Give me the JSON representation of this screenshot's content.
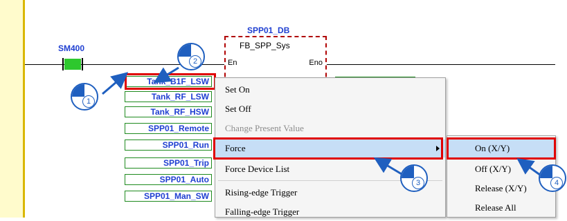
{
  "ladder": {
    "contact_label": "SM400",
    "fb_instance": "SPP01_DB",
    "fb_name": "FB_SPP_Sys",
    "fb_en": "En",
    "fb_eno": "Eno",
    "variables": [
      "Tank_B1F_LSW",
      "Tank_RF_LSW",
      "Tank_RF_HSW",
      "SPP01_Remote",
      "SPP01_Run",
      "SPP01_Trip",
      "SPP01_Auto",
      "SPP01_Man_SW"
    ]
  },
  "context_menu": {
    "items": [
      {
        "label": "Set On",
        "state": "normal"
      },
      {
        "label": "Set Off",
        "state": "normal"
      },
      {
        "label": "Change Present Value",
        "state": "disabled"
      },
      {
        "label": "Force",
        "state": "highlighted",
        "has_submenu": true
      },
      {
        "label": "Force Device List",
        "state": "normal"
      },
      {
        "label": "Rising-edge Trigger",
        "state": "normal"
      },
      {
        "label": "Falling-edge Trigger",
        "state": "normal"
      }
    ]
  },
  "force_submenu": {
    "items": [
      {
        "label": "On (X/Y)",
        "state": "highlighted"
      },
      {
        "label": "Off (X/Y)",
        "state": "normal"
      },
      {
        "label": "Release (X/Y)",
        "state": "normal"
      },
      {
        "label": "Release All",
        "state": "normal"
      }
    ]
  },
  "step_badges": [
    "1",
    "2",
    "3",
    "4"
  ],
  "icons": [
    "step-1-badge-icon",
    "step-2-badge-icon",
    "step-3-badge-icon",
    "step-4-badge-icon",
    "submenu-arrow-icon",
    "pointer-arrow-icon"
  ],
  "colors": {
    "variable_text": "#1f3fd1",
    "variable_border": "#1e8a1e",
    "contact_fill": "#2ec82e",
    "highlight": "#c6def6",
    "callout_red": "#e00000",
    "step_blue": "#1f5fbf",
    "left_rail": "#fffbcc"
  }
}
